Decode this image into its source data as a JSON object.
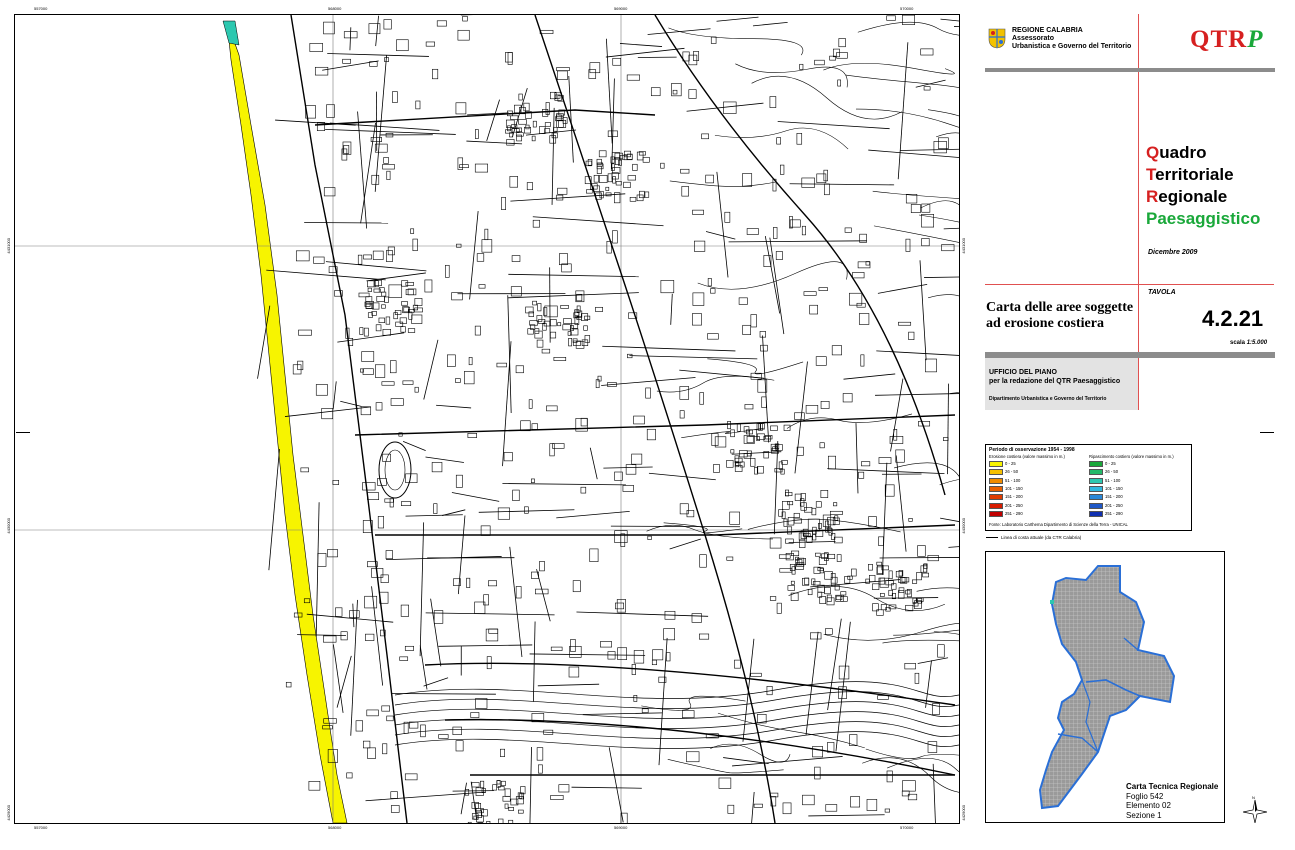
{
  "map": {
    "coords_top": [
      "557000",
      "568000",
      "569000",
      "570000"
    ],
    "coords_bottom": [
      "557000",
      "568000",
      "569000",
      "570000"
    ],
    "coords_left": [
      "4431000",
      "4430000",
      "4429000"
    ],
    "coords_right": [
      "4431000",
      "4430000",
      "4429000"
    ],
    "colors": {
      "erosion": "#f7f400",
      "coast_cyan": "#2cc8b0",
      "line": "#000000",
      "grid": "#7a7a7a"
    }
  },
  "header": {
    "region_name": "REGIONE CALABRIA",
    "department_line1": "Assessorato",
    "department_line2": "Urbanistica e Governo del Territorio",
    "logo_prefix": "QTR",
    "logo_suffix": "P",
    "logo_colors": {
      "prefix": "#d62020",
      "suffix": "#1aa83a"
    }
  },
  "plan_title": {
    "line1_initial": "Q",
    "line1_rest": "uadro",
    "line2_initial": "T",
    "line2_rest": "erritoriale",
    "line3_initial": "R",
    "line3_rest": "egionale",
    "line4": "Paesaggistico",
    "date": "Dicembre 2009"
  },
  "sheet": {
    "title_line1": "Carta delle aree soggette",
    "title_line2": "ad erosione costiera",
    "tavola_label": "TAVOLA",
    "number": "4.2.21",
    "scale_label": "scala ",
    "scale_value": "1:5.000"
  },
  "office": {
    "line1": "UFFICIO DEL PIANO",
    "line2": "per la redazione del QTR Paesaggistico",
    "line3": "Dipartimento Urbanistica e Governo del Territorio"
  },
  "legend": {
    "title": "Periodo di osservazione 1954 - 1998",
    "erosion_header": "Erosione costiera (valore massimo in m.)",
    "accretion_header": "Ripascimento costiero (valore massimo in m.)",
    "erosion_items": [
      {
        "label": "0 - 25",
        "color": "#f7f400"
      },
      {
        "label": "26 - 50",
        "color": "#f5c000"
      },
      {
        "label": "51 - 100",
        "color": "#f08c00"
      },
      {
        "label": "101 - 150",
        "color": "#e86000"
      },
      {
        "label": "151 - 200",
        "color": "#e03c00"
      },
      {
        "label": "201 - 250",
        "color": "#d81c00"
      },
      {
        "label": "251 - 290",
        "color": "#c00000"
      }
    ],
    "accretion_items": [
      {
        "label": "0 - 25",
        "color": "#1aa83a"
      },
      {
        "label": "26 - 50",
        "color": "#22b868"
      },
      {
        "label": "51 - 100",
        "color": "#2cc8b0"
      },
      {
        "label": "101 - 150",
        "color": "#30b8e0"
      },
      {
        "label": "151 - 200",
        "color": "#2a88d8"
      },
      {
        "label": "201 - 250",
        "color": "#1f58c8"
      },
      {
        "label": "251 - 290",
        "color": "#1030b0"
      }
    ],
    "source": "Fonte: Laboratorio Carthema Dipartimento di Scienze della Terra - UNICAL",
    "coastline_label": "Linea di costa attuale (da CTR Calabria)"
  },
  "inset": {
    "title": "Carta Tecnica Regionale",
    "foglio": "Foglio 542",
    "elemento": "Elemento 02",
    "sezione": "Sezione 1",
    "north_label": "N",
    "colors": {
      "region_fill": "#9a9a9a",
      "boundary": "#2a6fd6",
      "highlight": "#2cc8b0"
    }
  }
}
